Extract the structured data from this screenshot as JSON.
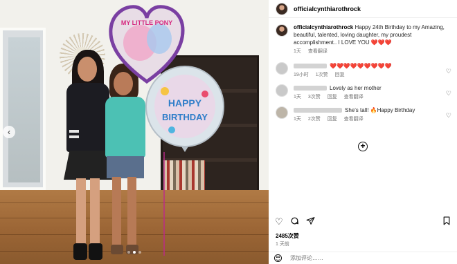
{
  "post": {
    "username": "officialcynthiarothrock",
    "caption_text": "Happy 24th Birthday to my Amazing, beautiful, talented, loving daughter, my proudest accomplishment.. I LOVE YOU ❤️❤️❤️",
    "caption_age": "1天",
    "caption_translate": "查看翻译",
    "likes": "2485次赞",
    "date": "1 天前",
    "comment_placeholder": "添加评论……",
    "heart_comment_text": "❤️❤️❤️❤️❤️❤️❤️❤️❤️",
    "carousel_dots": 3
  },
  "comments": [
    {
      "text": "❤️❤️❤️❤️❤️❤️❤️❤️❤️",
      "age": "19小时",
      "likes": "1次赞",
      "reply": "回复"
    },
    {
      "text": "Lovely as her mother",
      "age": "1天",
      "likes": "3次赞",
      "reply": "回复",
      "translate": "查看翻译"
    },
    {
      "text": "She's tall! 🔥Happy Birthday",
      "age": "1天",
      "likes": "2次赞",
      "reply": "回复",
      "translate": "查看翻译"
    }
  ],
  "balloon_texts": {
    "heart": "MY LITTLE PONY",
    "round_1": "HAPPY",
    "round_2": "BIRTHDAY"
  }
}
